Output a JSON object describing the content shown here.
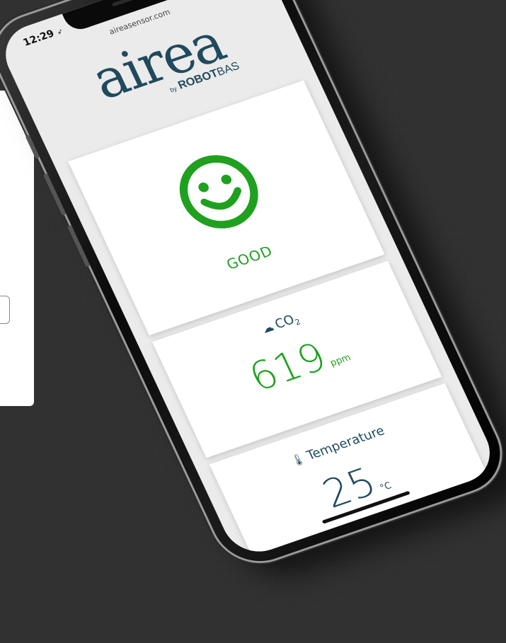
{
  "status_bar": {
    "time": "12:29",
    "url": "aireasensor.com"
  },
  "brand": {
    "logo": "airea",
    "by": "by",
    "robot": "ROBOT",
    "bas": "BAS"
  },
  "air_quality": {
    "status": "GOOD",
    "icon": "smiley-face-icon",
    "color": "#1fa01f"
  },
  "co2": {
    "label": "CO",
    "label_sub": "2",
    "icon": "co2-cloud-icon",
    "value": "619",
    "unit": "ppm"
  },
  "temperature": {
    "label": "Temperature",
    "icon": "thermometer-icon",
    "value": "25",
    "unit": "°C"
  },
  "colors": {
    "accent": "#1fa01f",
    "brand": "#1f4a5e",
    "background": "#2f2f2f"
  }
}
